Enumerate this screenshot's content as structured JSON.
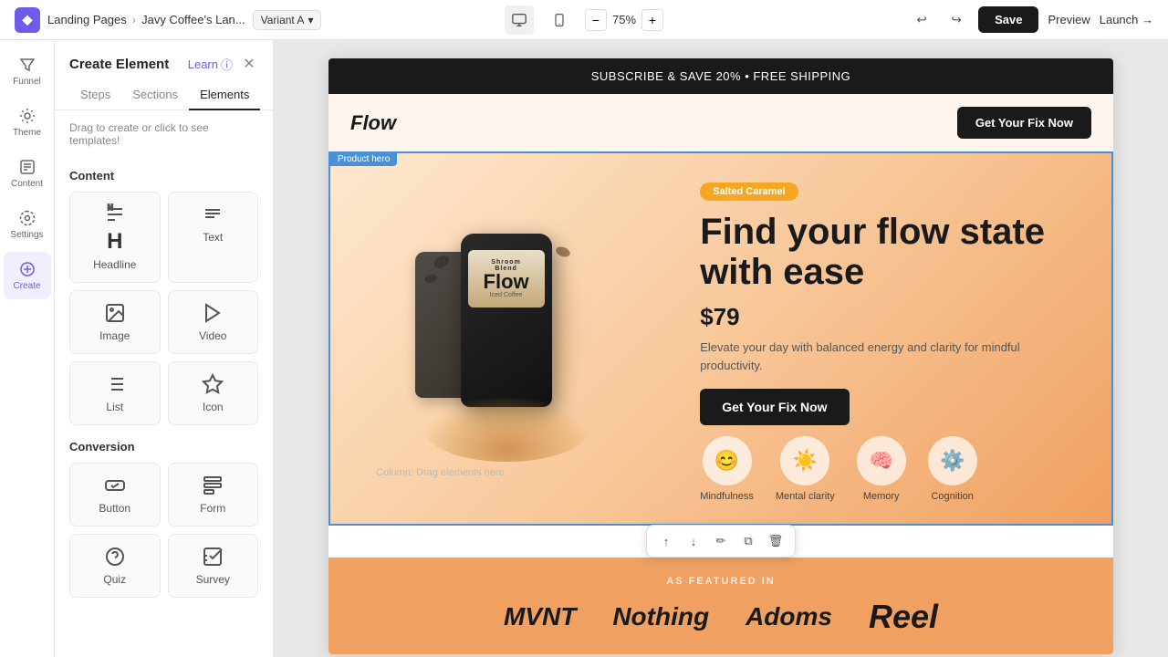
{
  "topbar": {
    "app_logo": "◆",
    "breadcrumb": {
      "parent": "Landing Pages",
      "separator": "›",
      "current": "Javy Coffee's Lan..."
    },
    "variant": "Variant A",
    "zoom": "75%",
    "undo_label": "↩",
    "redo_label": "↪",
    "save_label": "Save",
    "preview_label": "Preview",
    "launch_label": "Launch →"
  },
  "icon_sidebar": {
    "items": [
      {
        "id": "funnel",
        "label": "Funnel",
        "icon": "funnel"
      },
      {
        "id": "theme",
        "label": "Theme",
        "icon": "theme"
      },
      {
        "id": "content",
        "label": "Content",
        "icon": "content"
      },
      {
        "id": "settings",
        "label": "Settings",
        "icon": "settings"
      },
      {
        "id": "create",
        "label": "Create",
        "icon": "create",
        "active": true
      }
    ]
  },
  "panel": {
    "title": "Create Element",
    "learn_label": "Learn",
    "tabs": [
      "Steps",
      "Sections",
      "Elements"
    ],
    "active_tab": "Elements",
    "subtitle": "Drag to create or click to see templates!",
    "sections": {
      "content": {
        "label": "Content",
        "items": [
          {
            "id": "headline",
            "label": "Headline"
          },
          {
            "id": "text",
            "label": "Text"
          },
          {
            "id": "image",
            "label": "Image"
          },
          {
            "id": "video",
            "label": "Video"
          },
          {
            "id": "list",
            "label": "List"
          },
          {
            "id": "icon",
            "label": "Icon"
          }
        ]
      },
      "conversion": {
        "label": "Conversion",
        "items": [
          {
            "id": "button",
            "label": "Button"
          },
          {
            "id": "form",
            "label": "Form"
          },
          {
            "id": "quiz",
            "label": "Quiz"
          },
          {
            "id": "survey",
            "label": "Survey"
          }
        ]
      }
    }
  },
  "page": {
    "announce_bar": "SUBSCRIBE & SAVE 20% • FREE SHIPPING",
    "nav": {
      "logo": "Flow",
      "cta": "Get Your Fix Now"
    },
    "hero": {
      "label": "Product hero",
      "badge": "Salted Caramel",
      "title": "Find your flow state with ease",
      "price": "$79",
      "description": "Elevate your day with balanced energy and clarity for mindful productivity.",
      "cta": "Get Your Fix Now",
      "product": {
        "brand": "Shroom Blend",
        "name": "Flow",
        "sub": "Iced Coffee"
      },
      "column_placeholder": "Column: Drag elements here",
      "features": [
        {
          "id": "mindfulness",
          "label": "Mindfulness",
          "icon": "😊"
        },
        {
          "id": "mental-clarity",
          "label": "Mental clarity",
          "icon": "☀"
        },
        {
          "id": "memory",
          "label": "Memory",
          "icon": "🧠"
        },
        {
          "id": "cognition",
          "label": "Cognition",
          "icon": "⚙"
        }
      ]
    },
    "featured": {
      "label": "AS FEATURED IN",
      "brands": [
        "MVNT",
        "Nothing",
        "Adoms",
        "Reel"
      ]
    }
  },
  "float_toolbar": {
    "buttons": [
      "↑",
      "↓",
      "✏",
      "⧉",
      "🗑"
    ]
  }
}
